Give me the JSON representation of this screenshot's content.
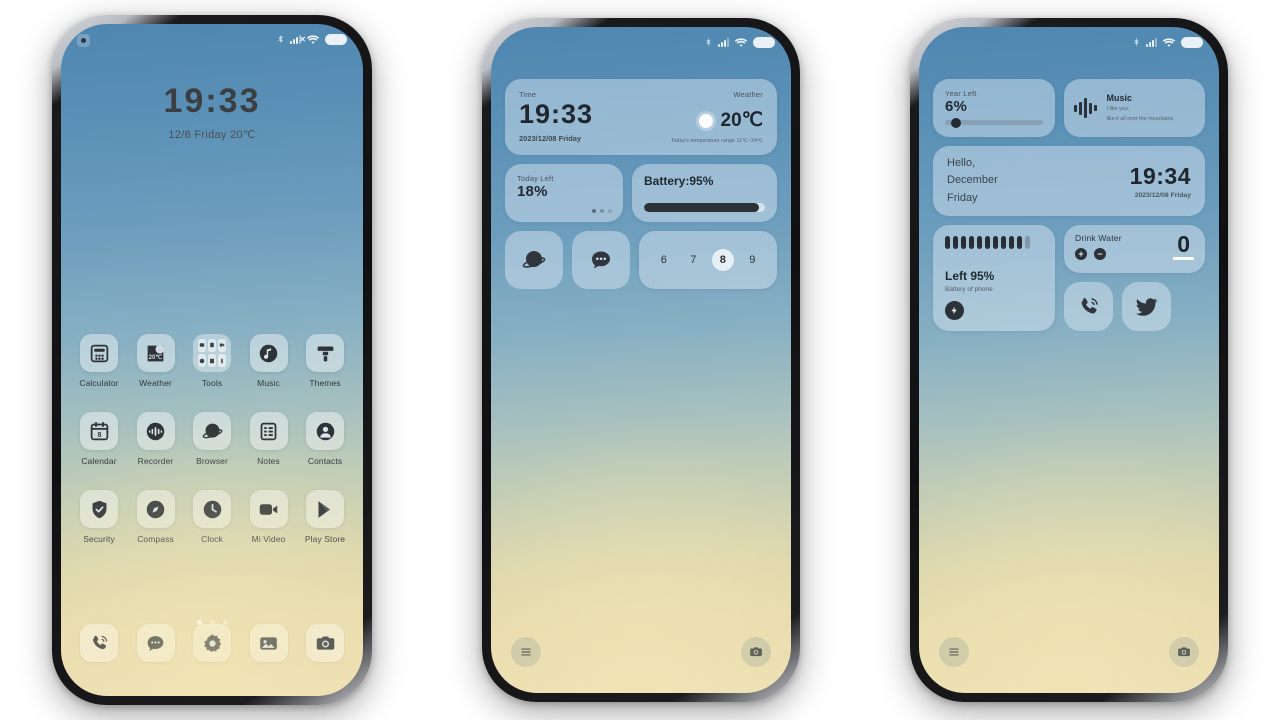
{
  "statusbar": {
    "bluetooth_icon": "bluetooth-icon",
    "signal_icon": "signal-bars-icon",
    "signal_x": "✕",
    "wifi_icon": "wifi-icon",
    "battery_icon": "battery-icon"
  },
  "phone1": {
    "clock": "19:33",
    "date_line": "12/8  Friday   20℃",
    "rows": [
      [
        {
          "label": "Calculator",
          "icon": "calculator-icon"
        },
        {
          "label": "Weather",
          "icon": "weather-icon",
          "badge": "20℃"
        },
        {
          "label": "Tools",
          "icon": "folder-tools-icon"
        },
        {
          "label": "Music",
          "icon": "music-note-icon"
        },
        {
          "label": "Themes",
          "icon": "themes-brush-icon"
        }
      ],
      [
        {
          "label": "Calendar",
          "icon": "calendar-icon",
          "badge": "8"
        },
        {
          "label": "Recorder",
          "icon": "recorder-icon"
        },
        {
          "label": "Browser",
          "icon": "browser-planet-icon"
        },
        {
          "label": "Notes",
          "icon": "notes-icon"
        },
        {
          "label": "Contacts",
          "icon": "contacts-icon"
        }
      ],
      [
        {
          "label": "Security",
          "icon": "shield-icon"
        },
        {
          "label": "Compass",
          "icon": "compass-icon"
        },
        {
          "label": "Clock",
          "icon": "clock-icon"
        },
        {
          "label": "Mi Video",
          "icon": "video-camera-icon"
        },
        {
          "label": "Play Store",
          "icon": "play-store-icon"
        }
      ]
    ],
    "dock": [
      {
        "label": "Phone",
        "icon": "phone-icon"
      },
      {
        "label": "Messages",
        "icon": "message-bubble-icon"
      },
      {
        "label": "Settings",
        "icon": "gear-icon"
      },
      {
        "label": "Gallery",
        "icon": "gallery-image-icon"
      },
      {
        "label": "Camera",
        "icon": "camera-icon"
      }
    ],
    "page_dots": 3,
    "active_dot": 0
  },
  "phone2": {
    "time_widget": {
      "time_label": "Time",
      "clock": "19:33",
      "date": "2023/12/08 Friday",
      "weather_label": "Weather",
      "temp": "20℃",
      "range": "Today's temperature range 11℃~24℃",
      "sun_icon": "sun-icon"
    },
    "today_widget": {
      "label": "Today Left",
      "value": "18%"
    },
    "battery_widget": {
      "label": "Battery:95%",
      "percent": 95
    },
    "browser_icon": "browser-planet-icon",
    "message_icon": "message-bubble-icon",
    "dates_widget": {
      "days": [
        "6",
        "7",
        "8",
        "9"
      ],
      "selected": "8"
    },
    "nav": {
      "menu_icon": "menu-icon",
      "camera_icon": "camera-icon"
    }
  },
  "phone3": {
    "year_widget": {
      "label": "Year Left",
      "value": "6%",
      "percent": 6
    },
    "music_widget": {
      "title": "Music",
      "line1": "I like you,",
      "line2": "like it all over the mountains",
      "eq_icon": "equalizer-icon"
    },
    "hello_widget": {
      "line1": "Hello,",
      "line2": "December",
      "line3": "Friday",
      "clock": "19:34",
      "date": "2023/12/08 Friday"
    },
    "battery_widget": {
      "title": "Left 95%",
      "subtitle": "Battery of phone",
      "bars_total": 11,
      "bars_filled": 10,
      "bolt_icon": "bolt-icon"
    },
    "water_widget": {
      "title": "Drink Water",
      "value": "0",
      "plus_label": "+",
      "minus_label": "−"
    },
    "phone_icon": "phone-icon",
    "twitter_icon": "twitter-bird-icon",
    "nav": {
      "menu_icon": "menu-icon",
      "camera_icon": "camera-icon"
    }
  },
  "colors": {
    "screen_top": "#4f86b0",
    "screen_bottom": "#ece0b4",
    "widget_glass": "rgba(222,234,244,0.46)",
    "icon_dark": "#2e3338"
  }
}
